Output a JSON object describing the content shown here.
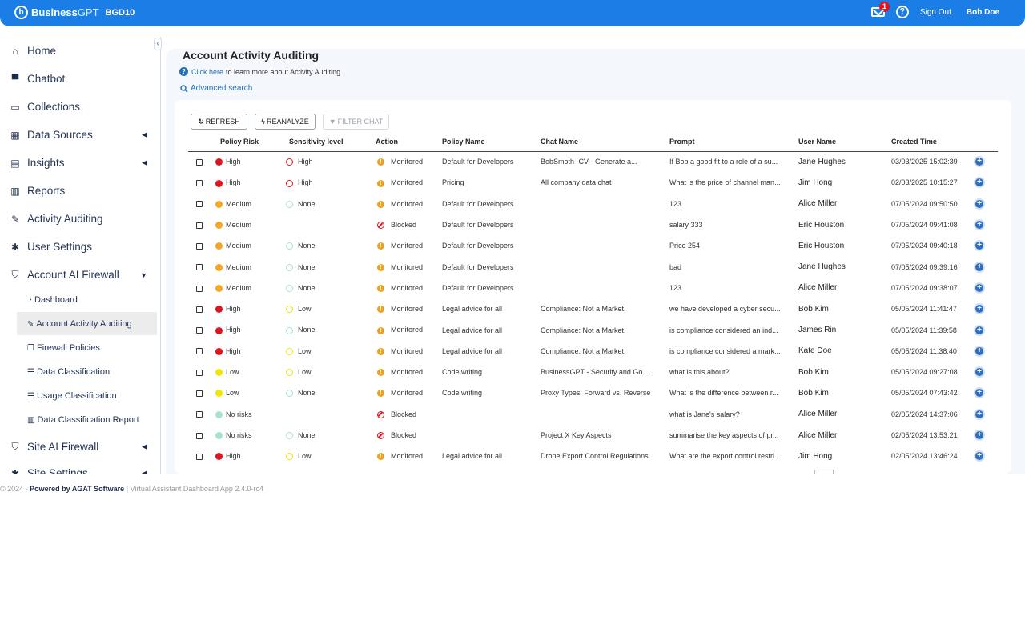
{
  "header": {
    "brand_logo": "b",
    "brand_name": "Business",
    "brand_suffix": "GPT",
    "tenant": "BGD10",
    "notification_count": "1",
    "help_glyph": "?",
    "sign_out": "Sign Out",
    "user": "Bob Doe"
  },
  "sidebar": {
    "collapse_glyph": "‹",
    "items": [
      {
        "label": "Home",
        "icon": "home-icon",
        "glyph": "⌂"
      },
      {
        "label": "Chatbot",
        "icon": "chat-icon",
        "glyph": "▀"
      },
      {
        "label": "Collections",
        "icon": "folder-icon",
        "glyph": "▭"
      },
      {
        "label": "Data Sources",
        "icon": "grid-icon",
        "glyph": "▦"
      },
      {
        "label": "Insights",
        "icon": "calendar-icon",
        "glyph": "▤"
      },
      {
        "label": "Reports",
        "icon": "bar-chart-icon",
        "glyph": "▥"
      },
      {
        "label": "Activity Auditing",
        "icon": "edit-icon",
        "glyph": "✎"
      },
      {
        "label": "User Settings",
        "icon": "gear-icon",
        "glyph": "✱"
      },
      {
        "label": "Account AI Firewall",
        "icon": "shield-icon",
        "glyph": "⛉"
      },
      {
        "label": "Site AI Firewall",
        "icon": "shield-icon",
        "glyph": "⛉"
      },
      {
        "label": "Site Settings",
        "icon": "gear-icon",
        "glyph": "✱"
      }
    ],
    "subitems": [
      {
        "label": "Dashboard",
        "icon": "dashboard-icon",
        "glyph": "◔"
      },
      {
        "label": "Account Activity Auditing",
        "icon": "edit-icon",
        "glyph": "✎"
      },
      {
        "label": "Firewall Policies",
        "icon": "copy-icon",
        "glyph": "❐"
      },
      {
        "label": "Data Classification",
        "icon": "list-icon",
        "glyph": "☰"
      },
      {
        "label": "Usage Classification",
        "icon": "list-icon",
        "glyph": "☰"
      },
      {
        "label": "Data Classification Report",
        "icon": "bar-chart-icon",
        "glyph": "▥"
      }
    ]
  },
  "page": {
    "title": "Account Activity Auditing",
    "help_link": "Click here",
    "help_text": "to learn more about Activity Auditing",
    "advanced_search": "Advanced search"
  },
  "toolbar": {
    "refresh": "REFRESH",
    "reanalyze": "REANALYZE",
    "filter_chat": "FILTER CHAT"
  },
  "colors": {
    "high": "#e0141e",
    "medium": "#f5a623",
    "low": "#f2e600",
    "none": "#a6e3cf",
    "monitored": "#f0a020",
    "blocked": "#e0141e",
    "accent": "#1a7ee6"
  },
  "table": {
    "columns": [
      "Policy Risk",
      "Sensitivity level",
      "Action",
      "Policy Name",
      "Chat Name",
      "Prompt",
      "User Name",
      "Created Time"
    ],
    "rows": [
      {
        "risk": "High",
        "sensitivity": "High",
        "action": "Monitored",
        "policy": "Default for Developers",
        "chat": "BobSmoth -CV - Generate a...",
        "prompt": "If Bob a good fit to a role of a su...",
        "user": "Jane Hughes",
        "time": "03/03/2025 15:02:39"
      },
      {
        "risk": "High",
        "sensitivity": "High",
        "action": "Monitored",
        "policy": "Pricing",
        "chat": "All company data chat",
        "prompt": "What is the price of channel man...",
        "user": "Jim Hong",
        "time": "02/03/2025 10:15:27"
      },
      {
        "risk": "Medium",
        "sensitivity": "None",
        "action": "Monitored",
        "policy": "Default for Developers",
        "chat": "",
        "prompt": "123",
        "user": "Alice  Miller",
        "time": "07/05/2024 09:50:50"
      },
      {
        "risk": "Medium",
        "sensitivity": "",
        "action": "Blocked",
        "policy": "Default for Developers",
        "chat": "",
        "prompt": "salary 333",
        "user": "Eric Houston",
        "time": "07/05/2024 09:41:08"
      },
      {
        "risk": "Medium",
        "sensitivity": "None",
        "action": "Monitored",
        "policy": "Default for Developers",
        "chat": "",
        "prompt": "Price 254",
        "user": "Eric Houston",
        "time": "07/05/2024 09:40:18"
      },
      {
        "risk": "Medium",
        "sensitivity": "None",
        "action": "Monitored",
        "policy": "Default for Developers",
        "chat": "",
        "prompt": "bad",
        "user": "Jane Hughes",
        "time": "07/05/2024 09:39:16"
      },
      {
        "risk": "Medium",
        "sensitivity": "None",
        "action": "Monitored",
        "policy": "Default for Developers",
        "chat": "",
        "prompt": "123",
        "user": "Alice  Miller",
        "time": "07/05/2024 09:38:07"
      },
      {
        "risk": "High",
        "sensitivity": "Low",
        "action": "Monitored",
        "policy": "Legal advice for all",
        "chat": "Compliance: Not a Market.",
        "prompt": "we have developed a cyber secu...",
        "user": "Bob Kim",
        "time": "05/05/2024 11:41:47"
      },
      {
        "risk": "High",
        "sensitivity": "None",
        "action": "Monitored",
        "policy": "Legal advice for all",
        "chat": "Compliance: Not a Market.",
        "prompt": "is compliance considered an ind...",
        "user": "James Rin",
        "time": "05/05/2024 11:39:58"
      },
      {
        "risk": "High",
        "sensitivity": "Low",
        "action": "Monitored",
        "policy": "Legal advice for all",
        "chat": "Compliance: Not a Market.",
        "prompt": "is compliance considered a mark...",
        "user": "Kate Doe",
        "time": "05/05/2024 11:38:40"
      },
      {
        "risk": "Low",
        "sensitivity": "Low",
        "action": "Monitored",
        "policy": "Code writing",
        "chat": "BusinessGPT - Security and Go...",
        "prompt": "what is this about?",
        "user": "Bob Kim",
        "time": "05/05/2024 09:27:08"
      },
      {
        "risk": "Low",
        "sensitivity": "None",
        "action": "Monitored",
        "policy": "Code writing",
        "chat": "Proxy Types: Forward vs. Reverse",
        "prompt": "What is the difference between r...",
        "user": "Bob Kim",
        "time": "05/05/2024 07:43:42"
      },
      {
        "risk": "No risks",
        "sensitivity": "",
        "action": "Blocked",
        "policy": "",
        "chat": "",
        "prompt": "what is Jane's salary?",
        "user": "Alice  Miller",
        "time": "02/05/2024 14:37:06"
      },
      {
        "risk": "No risks",
        "sensitivity": "None",
        "action": "Blocked",
        "policy": "",
        "chat": "Project X Key Aspects",
        "prompt": "summarise the key aspects of pr...",
        "user": "Alice  Miller",
        "time": "02/05/2024 13:53:21"
      },
      {
        "risk": "High",
        "sensitivity": "Low",
        "action": "Monitored",
        "policy": "Legal advice for all",
        "chat": "Drone Export Control Regulations",
        "prompt": "What are the export control restri...",
        "user": "Jim Hong",
        "time": "02/05/2024 13:46:24"
      }
    ]
  },
  "footer": {
    "copyright": "© 2024 - ",
    "powered": "Powered by AGAT Software",
    "version": " | Virtual Assistant Dashboard App 2.4.0-rc4"
  }
}
